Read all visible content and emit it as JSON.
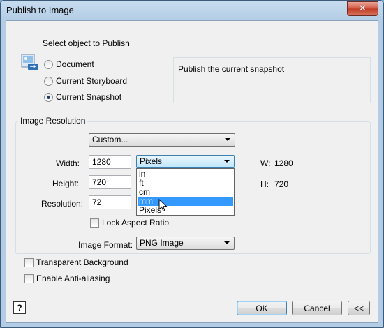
{
  "window": {
    "title": "Publish to Image",
    "close_glyph": "✕"
  },
  "publish": {
    "prompt": "Select object to Publish",
    "options": [
      "Document",
      "Current Storyboard",
      "Current Snapshot"
    ],
    "selected": "Current Snapshot",
    "description": "Publish the current snapshot"
  },
  "resolution": {
    "group_title": "Image Resolution",
    "preset_value": "Custom...",
    "width_label": "Width:",
    "width_value": "1280",
    "height_label": "Height:",
    "height_value": "720",
    "resolution_label": "Resolution:",
    "resolution_value": "72",
    "unit_value": "Pixels",
    "unit_options": [
      "in",
      "ft",
      "cm",
      "mm",
      "Pixels"
    ],
    "unit_highlighted": "mm",
    "w_readout_label": "W:",
    "w_readout_value": "1280",
    "h_readout_label": "H:",
    "h_readout_value": "720",
    "lock_aspect_label": "Lock Aspect Ratio"
  },
  "format": {
    "label": "Image Format:",
    "value": "PNG Image"
  },
  "options": {
    "transparent_label": "Transparent Background",
    "antialias_label": "Enable Anti-aliasing"
  },
  "footer": {
    "help_glyph": "?",
    "ok_label": "OK",
    "cancel_label": "Cancel",
    "collapse_label": "<<"
  },
  "colors": {
    "selection": "#3399ff",
    "title_bar": "#b3cde6"
  }
}
